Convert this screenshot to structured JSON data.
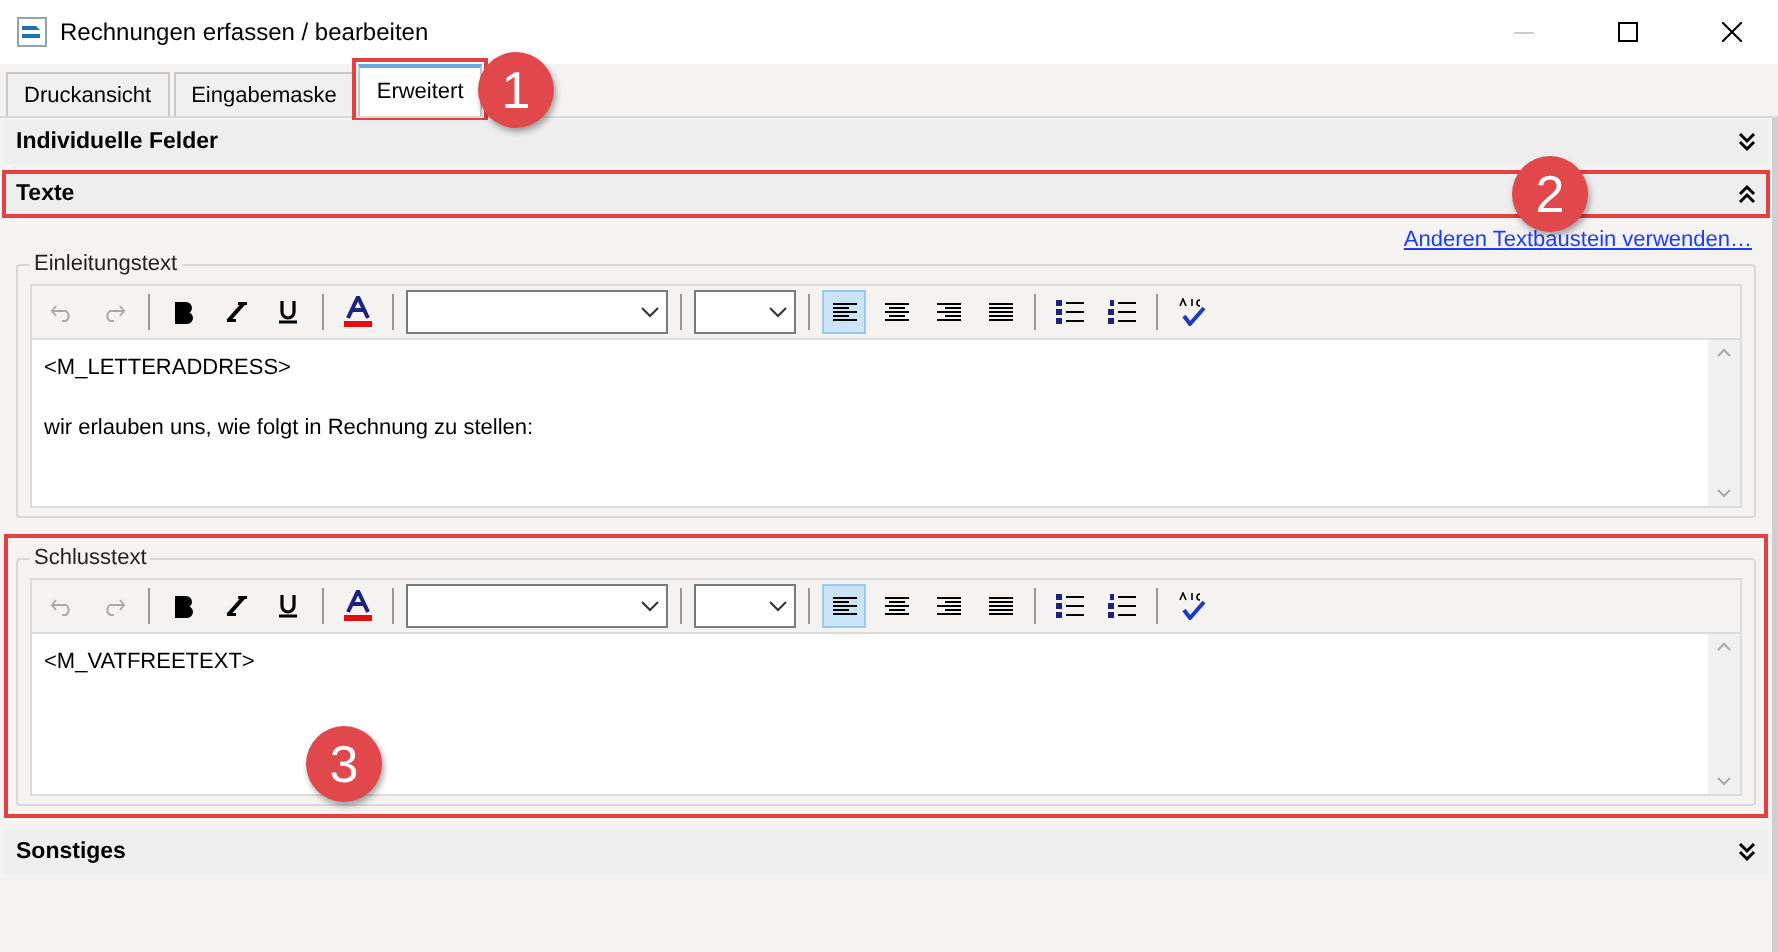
{
  "window": {
    "title": "Rechnungen erfassen / bearbeiten"
  },
  "tabs": [
    {
      "label": "Druckansicht",
      "selected": false,
      "highlighted": false
    },
    {
      "label": "Eingabemaske",
      "selected": false,
      "highlighted": false
    },
    {
      "label": "Erweitert",
      "selected": true,
      "highlighted": true
    }
  ],
  "sections": [
    {
      "title": "Individuelle Felder",
      "expanded": false,
      "highlighted": false
    },
    {
      "title": "Texte",
      "expanded": true,
      "highlighted": true,
      "link": "Anderen Textbaustein verwenden…",
      "editors": [
        {
          "label": "Einleitungstext",
          "highlighted": false,
          "lines": [
            "<M_LETTERADDRESS>",
            "wir erlauben uns, wie folgt in Rechnung zu stellen:"
          ],
          "alignment": [
            {
              "kind": "left",
              "selected": true
            },
            {
              "kind": "center",
              "selected": false
            },
            {
              "kind": "right",
              "selected": false
            },
            {
              "kind": "justify",
              "selected": false
            }
          ]
        },
        {
          "label": "Schlusstext",
          "highlighted": true,
          "lines": [
            "<M_VATFREETEXT>"
          ],
          "alignment": [
            {
              "kind": "left",
              "selected": true
            },
            {
              "kind": "center",
              "selected": false
            },
            {
              "kind": "right",
              "selected": false
            },
            {
              "kind": "justify",
              "selected": false
            }
          ]
        }
      ]
    },
    {
      "title": "Sonstiges",
      "expanded": false,
      "highlighted": false
    }
  ],
  "callouts": [
    {
      "number": "1"
    },
    {
      "number": "2"
    },
    {
      "number": "3"
    }
  ]
}
